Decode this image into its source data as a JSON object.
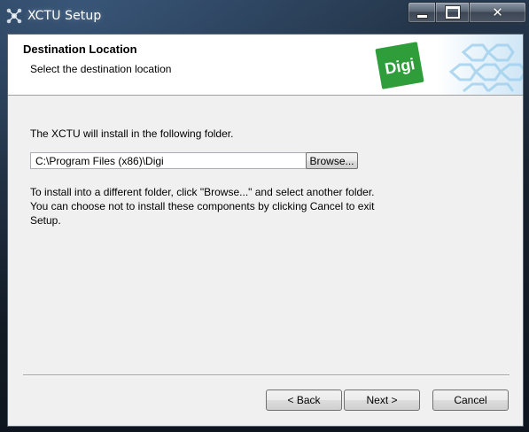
{
  "window": {
    "title": "XCTU Setup",
    "icon": "xctu-app-icon",
    "controls": {
      "minimize": "minimize-icon",
      "maximize": "maximize-icon",
      "close": "close-icon"
    }
  },
  "header": {
    "title": "Destination Location",
    "subtitle": "Select the destination location",
    "logo_text": "Digi",
    "brand_color": "#2f9e3a"
  },
  "body": {
    "intro": "The XCTU will install in the following folder.",
    "path_value": "C:\\Program Files (x86)\\Digi",
    "browse_label": "Browse...",
    "info_lines": [
      "To install into a different folder, click \"Browse...\" and select another folder.",
      "You can choose not to install these components by clicking Cancel to exit Setup."
    ]
  },
  "footer": {
    "back_label": "< Back",
    "next_label": "Next >",
    "cancel_label": "Cancel"
  }
}
